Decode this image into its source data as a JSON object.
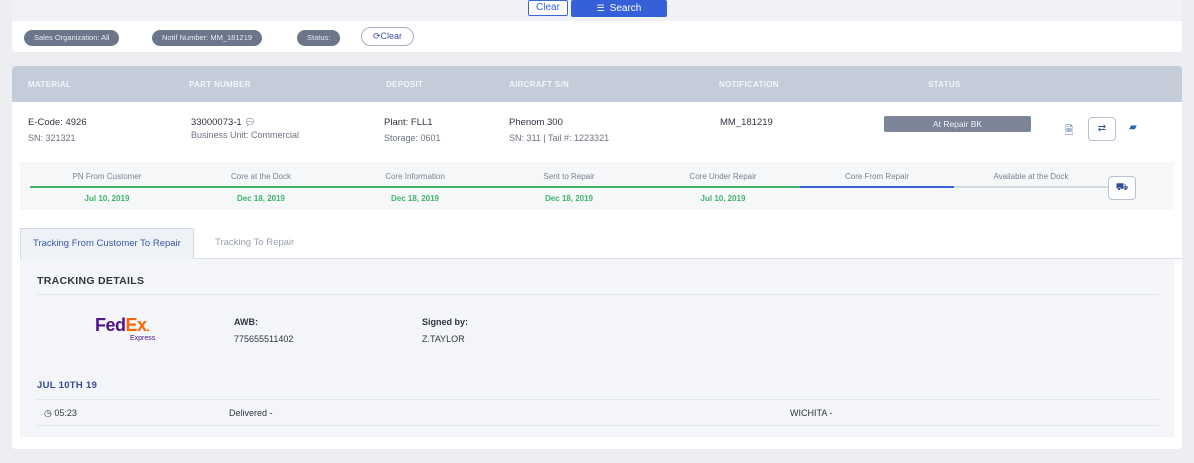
{
  "filters": {
    "clear_label": "Clear",
    "search_label": "Search",
    "search_icon": "sliders-icon",
    "chips": [
      "Sales Organization: All",
      "Notif Number: MM_181219",
      "Status:"
    ],
    "chip_clear_label": "Clear",
    "chip_clear_icon": "refresh-icon"
  },
  "table": {
    "headers": [
      "MATERIAL",
      "PART NUMBER",
      "DEPOSIT",
      "AIRCRAFT S/N",
      "NOTIFICATION",
      "STATUS"
    ],
    "row": {
      "material_code": "E-Code: 4926",
      "material_sn": "SN: 321321",
      "part_number": "33000073-1",
      "business_unit": "Business Unit: Commercial",
      "plant": "Plant: FLL1",
      "storage": "Storage: 0601",
      "aircraft": "Phenom 300",
      "aircraft_sn": "SN: 311 | Tail #: 1223321",
      "notification": "MM_181219",
      "status": "At Repair BK"
    }
  },
  "progress": {
    "steps": [
      {
        "label": "PN From Customer",
        "date": "Jul 10, 2019"
      },
      {
        "label": "Core at the Dock",
        "date": "Dec 18, 2019"
      },
      {
        "label": "Core Information",
        "date": "Dec 18, 2019"
      },
      {
        "label": "Sent to Repair",
        "date": "Dec 18, 2019"
      },
      {
        "label": "Core Under Repair",
        "date": "Jul 10, 2019"
      },
      {
        "label": "Core From Repair",
        "date": ""
      },
      {
        "label": "Available at the Dock",
        "date": ""
      }
    ],
    "colors": {
      "done": "#3fb46b",
      "current": "#3a66d6",
      "pending": "#d5d9e0"
    }
  },
  "tabs": [
    {
      "label": "Tracking From Customer To Repair",
      "active": true
    },
    {
      "label": "Tracking To Repair",
      "active": false
    }
  ],
  "tracking": {
    "title": "TRACKING DETAILS",
    "carrier": {
      "fed": "Fed",
      "ex": "Ex",
      "dot": ".",
      "sub": "Express"
    },
    "awb_label": "AWB:",
    "awb_value": "775655511402",
    "signed_label": "Signed by:",
    "signed_value": "Z.TAYLOR",
    "date_heading": "JUL 10TH 19",
    "events": [
      {
        "time": "05:23",
        "status": "Delivered -",
        "location": "WICHITA -"
      }
    ]
  }
}
